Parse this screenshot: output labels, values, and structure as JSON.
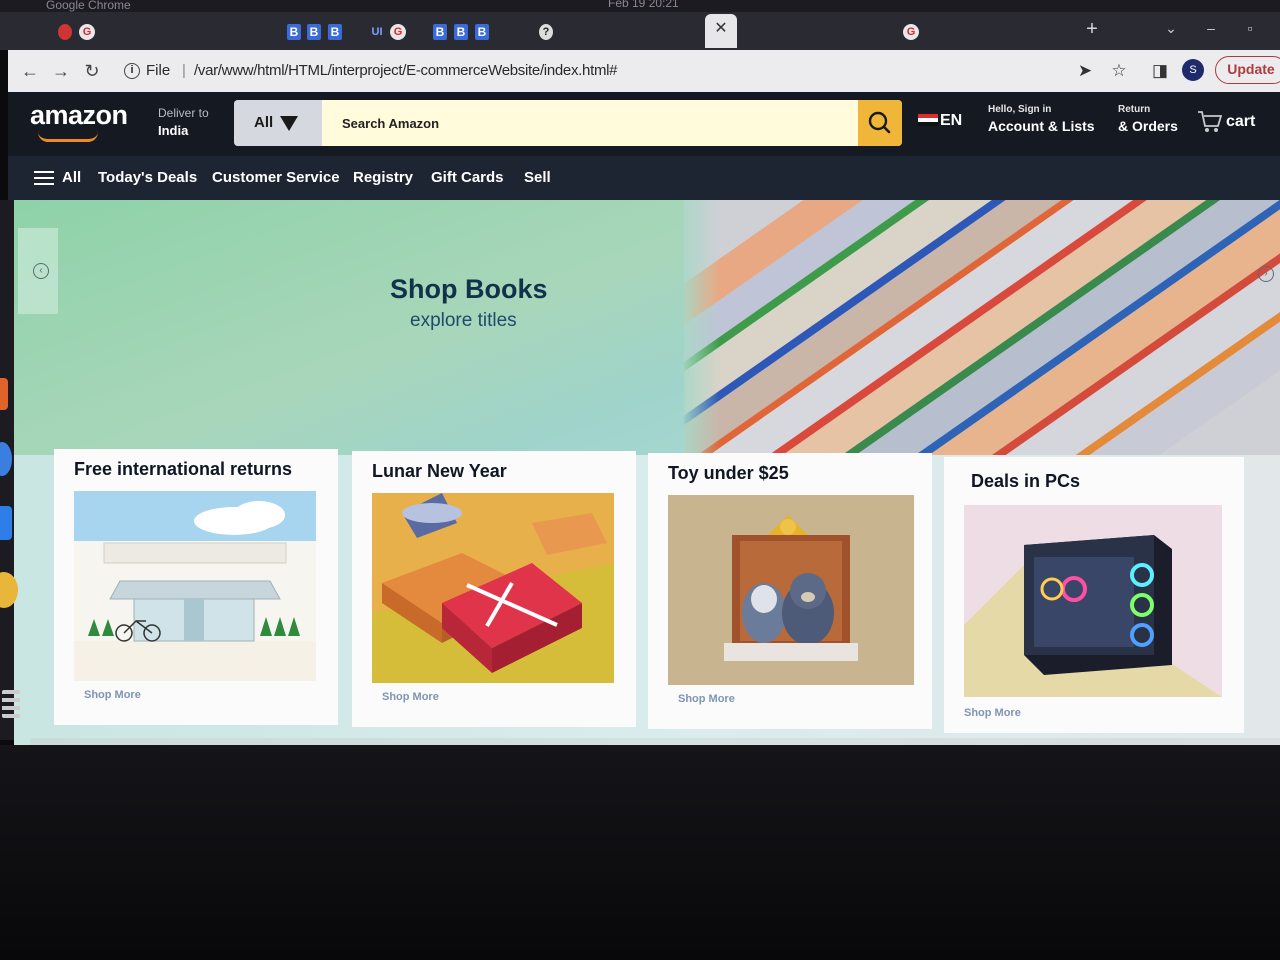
{
  "os": {
    "app_name": "Google Chrome",
    "clock": "Feb 19  20:21"
  },
  "tabs": {
    "new_tab_icon": "plus-icon",
    "close_icon": "close-icon",
    "b_label": "B",
    "ui_label": "UI",
    "g_label": "G",
    "q_label": "?"
  },
  "toolbar": {
    "scheme_label": "File",
    "separator": "|",
    "url": "/var/www/html/HTML/interproject/E-commerceWebsite/index.html#",
    "profile_initial": "S",
    "update_label": "Update"
  },
  "header": {
    "logo": "amazon",
    "deliver_line1": "Deliver to",
    "deliver_line2": "India",
    "search_category": "All",
    "search_placeholder": "Search Amazon",
    "language": "EN",
    "account_line1": "Hello, Sign in",
    "account_line2": "Account & Lists",
    "orders_line1": "Return",
    "orders_line2": "& Orders",
    "cart_label": "cart"
  },
  "nav": {
    "all_label": "All",
    "items": [
      "Today's Deals",
      "Customer Service",
      "Registry",
      "Gift Cards",
      "Sell"
    ]
  },
  "hero": {
    "title": "Shop Books",
    "subtitle": "explore titles"
  },
  "cards": [
    {
      "title": "Free international returns",
      "link": "Shop More"
    },
    {
      "title": "Lunar New Year",
      "link": "Shop More"
    },
    {
      "title": "Toy under $25",
      "link": "Shop More"
    },
    {
      "title": "Deals in PCs",
      "link": "Shop More"
    }
  ],
  "colors": {
    "header_bg": "#141922",
    "nav_bg": "#1e2532",
    "search_button": "#f0b63a",
    "logo_smile": "#f08a24",
    "hero_green": "#8ed2a8",
    "card_link": "#7f95b2"
  }
}
